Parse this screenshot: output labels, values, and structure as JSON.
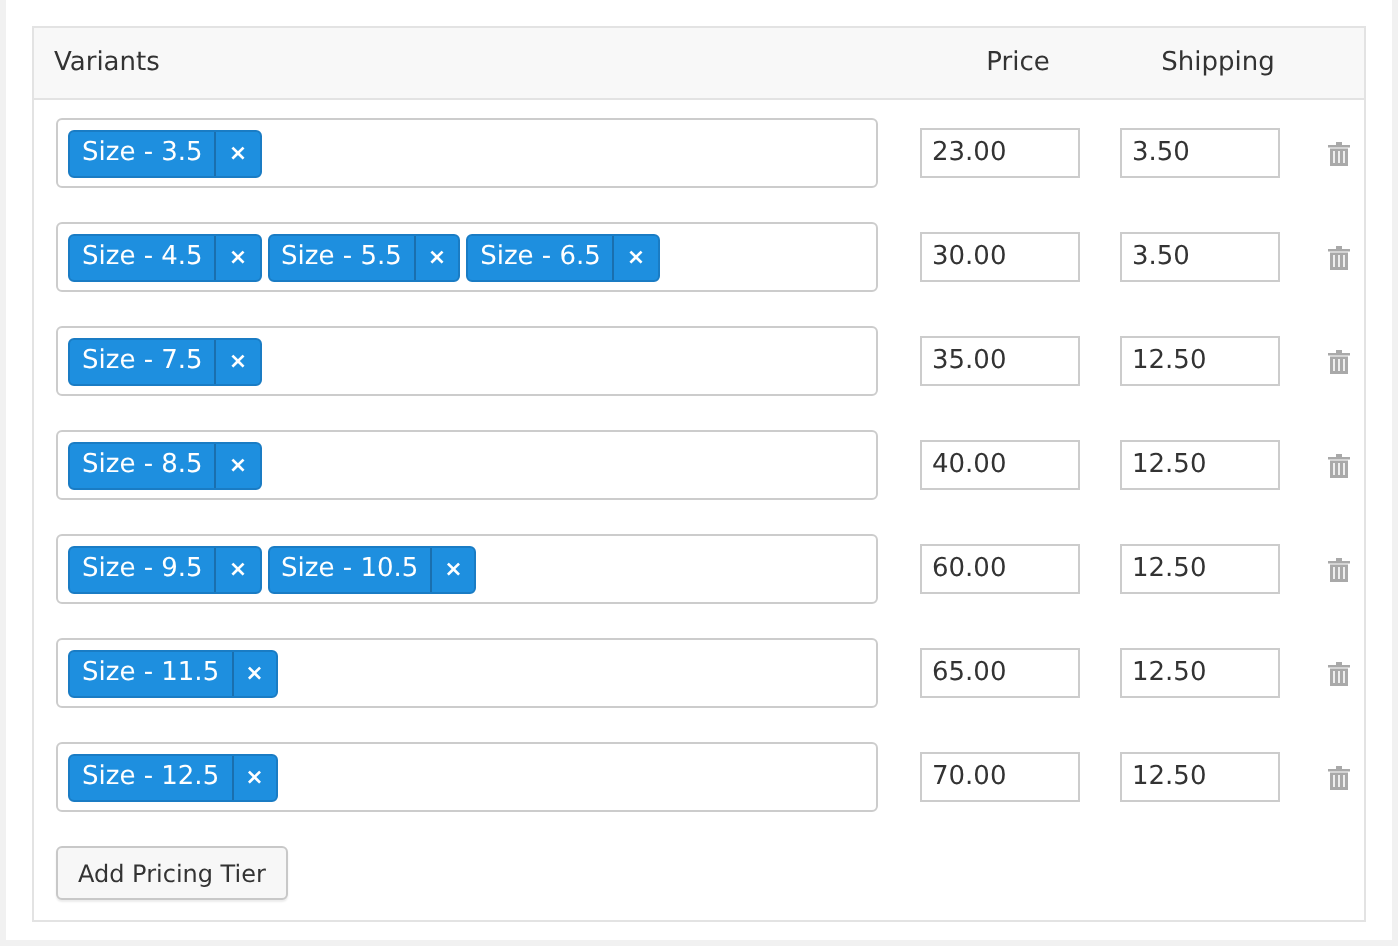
{
  "columns": {
    "variants": "Variants",
    "price": "Price",
    "shipping": "Shipping"
  },
  "rows": [
    {
      "tags": [
        {
          "label": "Size - 3.5",
          "remove": "×"
        }
      ],
      "price": "23.00",
      "shipping": "3.50"
    },
    {
      "tags": [
        {
          "label": "Size - 4.5",
          "remove": "×"
        },
        {
          "label": "Size - 5.5",
          "remove": "×"
        },
        {
          "label": "Size - 6.5",
          "remove": "×"
        }
      ],
      "price": "30.00",
      "shipping": "3.50"
    },
    {
      "tags": [
        {
          "label": "Size - 7.5",
          "remove": "×"
        }
      ],
      "price": "35.00",
      "shipping": "12.50"
    },
    {
      "tags": [
        {
          "label": "Size - 8.5",
          "remove": "×"
        }
      ],
      "price": "40.00",
      "shipping": "12.50"
    },
    {
      "tags": [
        {
          "label": "Size - 9.5",
          "remove": "×"
        },
        {
          "label": "Size - 10.5",
          "remove": "×"
        }
      ],
      "price": "60.00",
      "shipping": "12.50"
    },
    {
      "tags": [
        {
          "label": "Size - 11.5",
          "remove": "×"
        }
      ],
      "price": "65.00",
      "shipping": "12.50"
    },
    {
      "tags": [
        {
          "label": "Size - 12.5",
          "remove": "×"
        }
      ],
      "price": "70.00",
      "shipping": "12.50"
    }
  ],
  "add_button": "Add Pricing Tier"
}
